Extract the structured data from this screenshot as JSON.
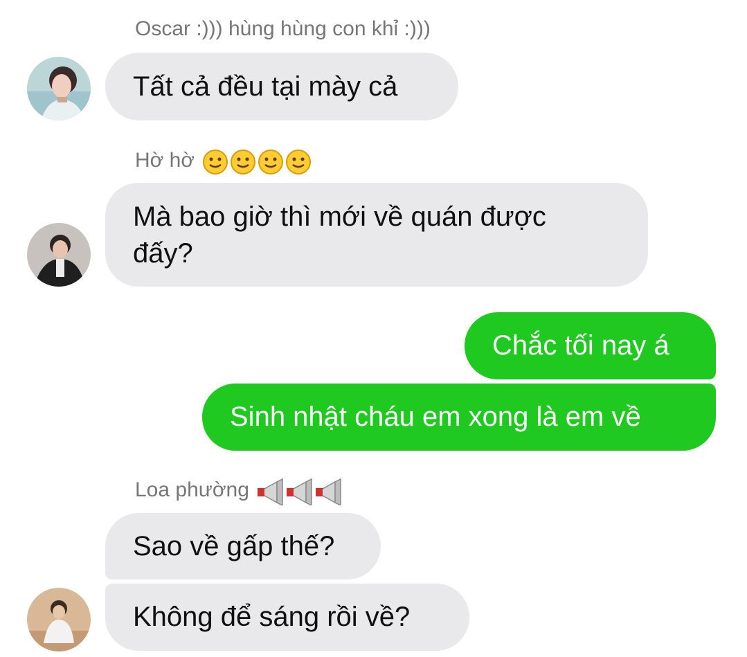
{
  "messages": {
    "group1": {
      "sender": "Oscar :))) hùng hùng con khỉ :)))",
      "bubbles": [
        "Tất cả đều tại mày cả"
      ]
    },
    "group2": {
      "sender": "Hờ hờ",
      "sender_emoji": "slightly-smiling-face-icon x4",
      "line1": "Mà bao giờ thì mới về quán được",
      "line2": "đấy?"
    },
    "outgoing": {
      "bubbles": [
        "Chắc tối nay á",
        "Sinh nhật cháu em xong là em về"
      ]
    },
    "group3": {
      "sender": "Loa phường",
      "sender_emoji": "megaphone-icon x3",
      "bubbles": [
        "Sao về gấp thế?",
        "Không để sáng rồi về?"
      ]
    }
  },
  "colors": {
    "incoming_bubble": "#e9e9eb",
    "outgoing_bubble": "#1fc91f",
    "sender_name": "#767676"
  }
}
